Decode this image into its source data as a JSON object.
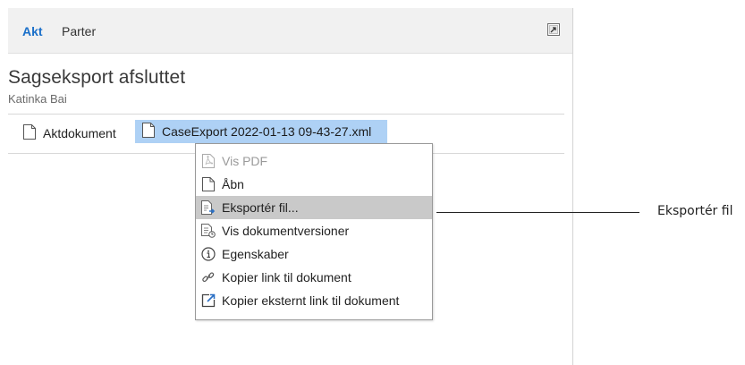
{
  "tabs": [
    {
      "label": "Akt",
      "active": true
    },
    {
      "label": "Parter",
      "active": false
    }
  ],
  "case": {
    "title": "Sagseksport afsluttet",
    "subtitle": "Katinka Bai"
  },
  "documents": [
    {
      "label": "Aktdokument",
      "icon": "file-icon",
      "selected": false
    },
    {
      "label": "CaseExport 2022-01-13 09-43-27.xml",
      "icon": "file-icon",
      "selected": true
    }
  ],
  "context_menu": {
    "items": [
      {
        "label": "Vis PDF",
        "icon": "pdf-icon",
        "enabled": false,
        "highlighted": false
      },
      {
        "label": "Åbn",
        "icon": "file-icon",
        "enabled": true,
        "highlighted": false
      },
      {
        "label": "Eksportér fil...",
        "icon": "export-file-icon",
        "enabled": true,
        "highlighted": true
      },
      {
        "label": "Vis dokumentversioner",
        "icon": "document-versions-icon",
        "enabled": true,
        "highlighted": false
      },
      {
        "label": "Egenskaber",
        "icon": "info-icon",
        "enabled": true,
        "highlighted": false
      },
      {
        "label": "Kopier link til dokument",
        "icon": "link-icon",
        "enabled": true,
        "highlighted": false
      },
      {
        "label": "Kopier eksternt link til dokument",
        "icon": "external-link-icon",
        "enabled": true,
        "highlighted": false
      }
    ]
  },
  "annotation": {
    "label": "Eksportér fil"
  },
  "colors": {
    "accent": "#1a6fc9",
    "selection": "#aed1f5",
    "menu_highlight": "#c9c9c9",
    "tabbar_bg": "#f1f1f1"
  }
}
